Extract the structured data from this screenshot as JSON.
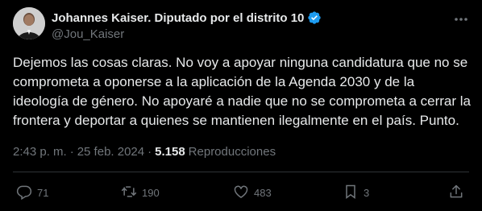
{
  "author": {
    "name": "Johannes Kaiser. Diputado por el distrito 10",
    "handle": "@Jou_Kaiser",
    "verified_icon": "verified-badge-icon",
    "verified_color": "#1d9bf0"
  },
  "tweet": {
    "text": "Dejemos las cosas claras. No voy a apoyar ninguna candidatura que no se comprometa a oponerse a la aplicación de la Agenda 2030 y de la ideología de género. No apoyaré a nadie que no se comprometa a cerrar la frontera y deportar a quienes se mantienen ilegalmente en el país. Punto."
  },
  "meta": {
    "time": "2:43 p. m.",
    "separator": "·",
    "date": "25 feb. 2024",
    "views_count": "5.158",
    "views_label": "Reproducciones"
  },
  "actions": {
    "replies": "71",
    "retweets": "190",
    "likes": "483",
    "bookmarks": "3"
  },
  "colors": {
    "background": "#000000",
    "text_primary": "#e7e9ea",
    "text_secondary": "#71767b",
    "divider": "#2f3336"
  }
}
